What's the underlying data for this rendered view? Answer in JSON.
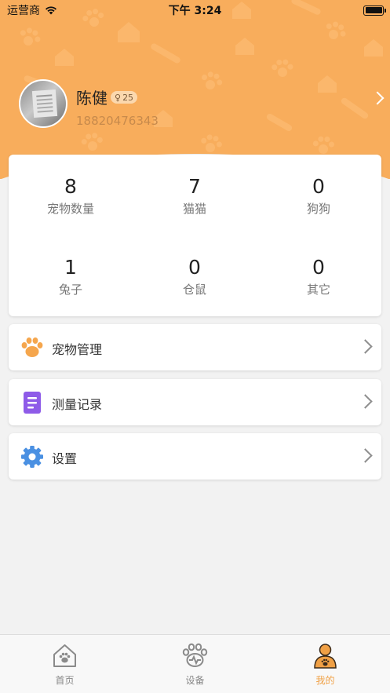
{
  "status_bar": {
    "carrier": "运营商",
    "time": "下午 3:24"
  },
  "profile": {
    "name": "陈健",
    "gender_symbol": "♀",
    "age": "25",
    "phone": "18820476343"
  },
  "stats": [
    {
      "value": "8",
      "label": "宠物数量"
    },
    {
      "value": "7",
      "label": "猫猫"
    },
    {
      "value": "0",
      "label": "狗狗"
    },
    {
      "value": "1",
      "label": "兔子"
    },
    {
      "value": "0",
      "label": "仓鼠"
    },
    {
      "value": "0",
      "label": "其它"
    }
  ],
  "menu": [
    {
      "label": "宠物管理",
      "icon": "paw-icon"
    },
    {
      "label": "测量记录",
      "icon": "document-icon"
    },
    {
      "label": "设置",
      "icon": "gear-icon"
    }
  ],
  "tabbar": {
    "items": [
      {
        "label": "首页",
        "icon": "home-icon"
      },
      {
        "label": "设备",
        "icon": "device-paw-icon"
      },
      {
        "label": "我的",
        "icon": "profile-icon"
      }
    ],
    "active_index": 2
  },
  "colors": {
    "header": "#f8ad5c",
    "accent": "#f0a045",
    "document_icon": "#8e5be8",
    "gear_icon": "#4a90e2"
  }
}
